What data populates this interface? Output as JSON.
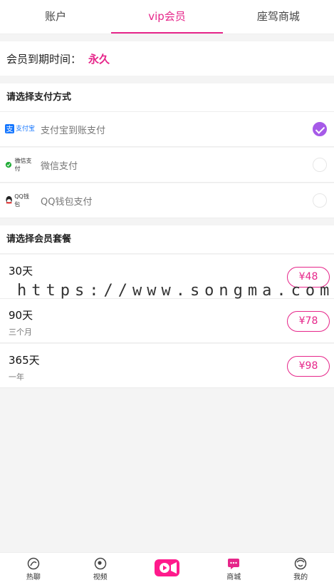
{
  "tabs": [
    {
      "label": "账户"
    },
    {
      "label": "vip会员"
    },
    {
      "label": "座驾商城"
    }
  ],
  "expire": {
    "label": "会员到期时间：",
    "value": "永久"
  },
  "payment": {
    "title": "请选择支付方式",
    "options": [
      {
        "label": "支付宝到账支付",
        "logo_text": "支付宝",
        "icon": "alipay-logo",
        "checked": true
      },
      {
        "label": "微信支付",
        "logo_text": "微信支付",
        "icon": "wechat-pay-logo",
        "checked": false
      },
      {
        "label": "QQ钱包支付",
        "logo_text": "QQ钱包",
        "icon": "qq-wallet-logo",
        "checked": false
      }
    ]
  },
  "plans": {
    "title": "请选择会员套餐",
    "items": [
      {
        "name": "30天",
        "sub": "",
        "price": "¥48"
      },
      {
        "name": "90天",
        "sub": "三个月",
        "price": "¥78"
      },
      {
        "name": "365天",
        "sub": "一年",
        "price": "¥98"
      }
    ]
  },
  "watermark": "https://www.songma.com",
  "nav": [
    {
      "label": "热聊",
      "icon": "chat-bubble-icon"
    },
    {
      "label": "视频",
      "icon": "video-eye-icon"
    },
    {
      "label": "",
      "icon": "camera-record-icon"
    },
    {
      "label": "商城",
      "icon": "shop-message-icon"
    },
    {
      "label": "我的",
      "icon": "profile-face-icon"
    }
  ],
  "colors": {
    "accent": "#e6268a",
    "check": "#a65ae8"
  }
}
